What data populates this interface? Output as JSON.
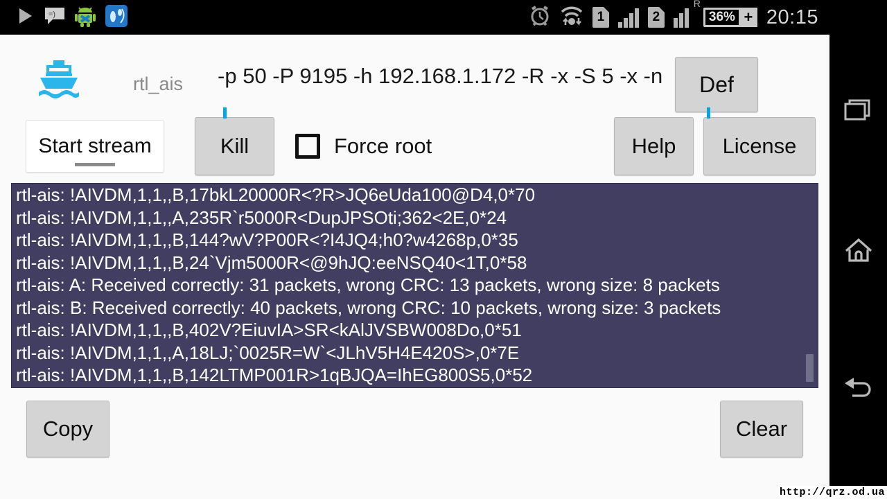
{
  "statusbar": {
    "icons_left": [
      "play-icon",
      "sms-icon",
      "android-robot-icon",
      "footsteps-app-icon"
    ],
    "alarm_icon": "alarm-clock-icon",
    "wifi_icon": "wifi-transfer-icon",
    "sim1_label": "1",
    "sim1_signal": "signal-bars-icon",
    "sim2_label": "2",
    "sim2_roaming": "R",
    "sim2_signal": "signal-bars-icon",
    "battery_percent": "36%",
    "battery_charging_glyph": "+",
    "clock": "20:15"
  },
  "header": {
    "app_icon": "boat-icon",
    "app_name": "rtl_ais",
    "command_args": "-p 50 -P 9195 -h 192.168.1.172 -R -x -S 5 -x -n",
    "def_label": "Def"
  },
  "controls": {
    "stream_spinner_value": "Start stream",
    "kill_label": "Kill",
    "force_root_label": "Force root",
    "force_root_checked": false,
    "help_label": "Help",
    "license_label": "License"
  },
  "log": {
    "lines": [
      "rtl-ais: !AIVDM,1,1,,B,17bkL20000R<?R>JQ6eUda100@D4,0*70",
      "rtl-ais: !AIVDM,1,1,,A,235R`r5000R<DupJPSOti;362<2E,0*24",
      "rtl-ais: !AIVDM,1,1,,B,144?wV?P00R<?I4JQ4;h0?w4268p,0*35",
      "rtl-ais: !AIVDM,1,1,,B,24`Vjm5000R<@9hJQ:eeNSQ40<1T,0*58",
      "rtl-ais: A: Received correctly: 31 packets, wrong CRC: 13 packets, wrong size: 8 packets",
      "rtl-ais: B: Received correctly: 40 packets, wrong CRC: 10 packets, wrong size: 3 packets",
      "rtl-ais: !AIVDM,1,1,,B,402V?EiuvIA>SR<kAlJVSBW008Do,0*51",
      "rtl-ais: !AIVDM,1,1,,A,18LJ;`0025R=W`<JLhV5H4E420S>,0*7E",
      "rtl-ais: !AIVDM,1,1,,B,142LTMP001R>1qBJQA=IhEG800S5,0*52"
    ]
  },
  "bottom": {
    "copy_label": "Copy",
    "clear_label": "Clear"
  },
  "navbar": {
    "recents": "recent-apps-icon",
    "home": "home-icon",
    "back": "back-icon"
  },
  "watermark": "http://qrz.od.ua",
  "colors": {
    "accent_blue": "#00a6dd",
    "log_background": "#413e61",
    "app_background": "#fafafa",
    "button_face": "#d4d4d4"
  }
}
